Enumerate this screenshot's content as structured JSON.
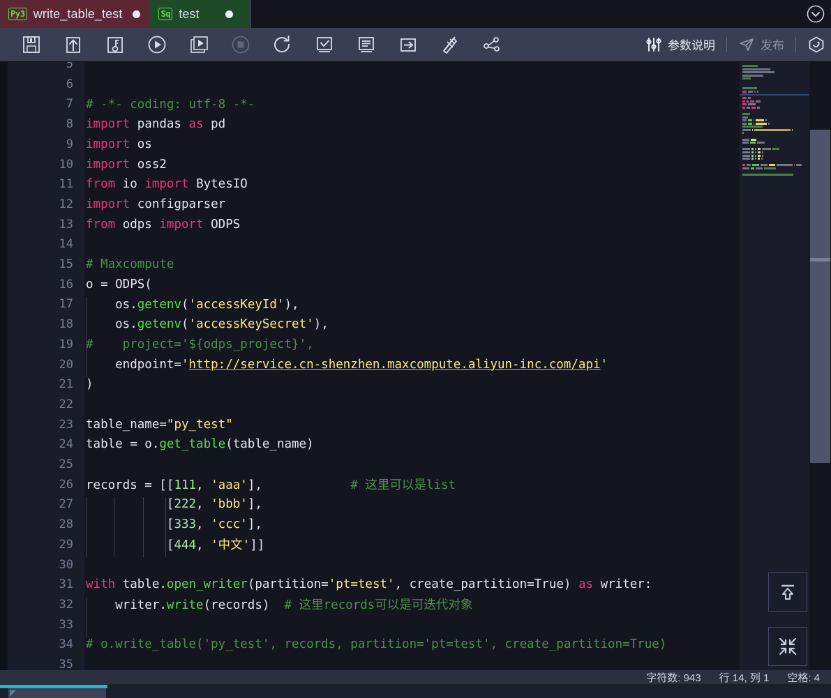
{
  "tabs": [
    {
      "badge": "Py3",
      "label": "write_table_test",
      "modified": true,
      "kind": "python",
      "active": true
    },
    {
      "badge": "Sq",
      "label": "test",
      "modified": true,
      "kind": "sql",
      "active": false
    }
  ],
  "titlebar": {
    "collapse_icon": "chevron-down-circle-icon"
  },
  "toolbar": {
    "buttons": [
      {
        "name": "save-button",
        "icon": "floppy-disk-icon",
        "enabled": true
      },
      {
        "name": "upload-button",
        "icon": "upload-box-icon",
        "enabled": true
      },
      {
        "name": "debug-button",
        "icon": "key-box-icon",
        "enabled": true
      },
      {
        "name": "run-button",
        "icon": "play-circle-icon",
        "enabled": true
      },
      {
        "name": "run-step-button",
        "icon": "play-box-icon",
        "enabled": true
      },
      {
        "name": "stop-button",
        "icon": "stop-circle-icon",
        "enabled": false
      },
      {
        "name": "refresh-button",
        "icon": "refresh-icon",
        "enabled": true
      },
      {
        "name": "check-button",
        "icon": "check-box-icon",
        "enabled": true
      },
      {
        "name": "format-button",
        "icon": "lines-box-icon",
        "enabled": true
      },
      {
        "name": "run-to-cursor-button",
        "icon": "arrow-right-box-icon",
        "enabled": true
      },
      {
        "name": "beautify-button",
        "icon": "pencil-ruler-icon",
        "enabled": true
      },
      {
        "name": "lineage-button",
        "icon": "node-graph-icon",
        "enabled": true
      }
    ],
    "params_label": "参数说明",
    "params_icon": "sliders-icon",
    "publish_label": "发布",
    "publish_icon": "send-icon",
    "publish_enabled": false,
    "more_icon": "hexagon-icon"
  },
  "editor": {
    "first_visible_line": 5,
    "lines": [
      {
        "n": 5,
        "tokens": []
      },
      {
        "n": 6,
        "tokens": []
      },
      {
        "n": 7,
        "tokens": [
          {
            "t": "# -*- coding: utf-8 -*-",
            "c": "cmt"
          }
        ]
      },
      {
        "n": 8,
        "tokens": [
          {
            "t": "import",
            "c": "kw"
          },
          {
            "t": " pandas ",
            "c": "pl"
          },
          {
            "t": "as",
            "c": "kw"
          },
          {
            "t": " pd",
            "c": "pl"
          }
        ]
      },
      {
        "n": 9,
        "tokens": [
          {
            "t": "import",
            "c": "kw"
          },
          {
            "t": " os",
            "c": "pl"
          }
        ]
      },
      {
        "n": 10,
        "tokens": [
          {
            "t": "import",
            "c": "kw"
          },
          {
            "t": " oss2",
            "c": "pl"
          }
        ]
      },
      {
        "n": 11,
        "tokens": [
          {
            "t": "from",
            "c": "kw"
          },
          {
            "t": " io ",
            "c": "pl"
          },
          {
            "t": "import",
            "c": "kw"
          },
          {
            "t": " BytesIO",
            "c": "pl"
          }
        ]
      },
      {
        "n": 12,
        "tokens": [
          {
            "t": "import",
            "c": "kw"
          },
          {
            "t": " configparser",
            "c": "pl"
          }
        ]
      },
      {
        "n": 13,
        "tokens": [
          {
            "t": "from",
            "c": "kw"
          },
          {
            "t": " odps ",
            "c": "pl"
          },
          {
            "t": "import",
            "c": "kw"
          },
          {
            "t": " ODPS",
            "c": "pl"
          }
        ]
      },
      {
        "n": 14,
        "tokens": []
      },
      {
        "n": 15,
        "tokens": [
          {
            "t": "# Maxcompute",
            "c": "cmt"
          }
        ]
      },
      {
        "n": 16,
        "tokens": [
          {
            "t": "o = ODPS(",
            "c": "pl"
          }
        ]
      },
      {
        "n": 17,
        "tokens": [
          {
            "t": "    os.",
            "c": "pl"
          },
          {
            "t": "getenv",
            "c": "fn"
          },
          {
            "t": "(",
            "c": "pl"
          },
          {
            "t": "'accessKeyId'",
            "c": "str"
          },
          {
            "t": "),",
            "c": "pl"
          }
        ]
      },
      {
        "n": 18,
        "tokens": [
          {
            "t": "    os.",
            "c": "pl"
          },
          {
            "t": "getenv",
            "c": "fn"
          },
          {
            "t": "(",
            "c": "pl"
          },
          {
            "t": "'accessKeySecret'",
            "c": "str"
          },
          {
            "t": "),",
            "c": "pl"
          }
        ]
      },
      {
        "n": 19,
        "tokens": [
          {
            "t": "#    project='${odps_project}',",
            "c": "cmt"
          }
        ]
      },
      {
        "n": 20,
        "tokens": [
          {
            "t": "    endpoint=",
            "c": "pl"
          },
          {
            "t": "'",
            "c": "str"
          },
          {
            "t": "http://service.cn-shenzhen.maxcompute.aliyun-inc.com/api",
            "c": "url"
          },
          {
            "t": "'",
            "c": "str"
          }
        ]
      },
      {
        "n": 21,
        "tokens": [
          {
            "t": ")",
            "c": "pl"
          }
        ]
      },
      {
        "n": 22,
        "tokens": []
      },
      {
        "n": 23,
        "tokens": [
          {
            "t": "table_name=",
            "c": "pl"
          },
          {
            "t": "\"py_test\"",
            "c": "str"
          }
        ]
      },
      {
        "n": 24,
        "tokens": [
          {
            "t": "table = o.",
            "c": "pl"
          },
          {
            "t": "get_table",
            "c": "fn"
          },
          {
            "t": "(table_name)",
            "c": "pl"
          }
        ]
      },
      {
        "n": 25,
        "tokens": []
      },
      {
        "n": 26,
        "tokens": [
          {
            "t": "records = [[",
            "c": "pl"
          },
          {
            "t": "111",
            "c": "num"
          },
          {
            "t": ", ",
            "c": "pl"
          },
          {
            "t": "'aaa'",
            "c": "str"
          },
          {
            "t": "],            ",
            "c": "pl"
          },
          {
            "t": "# 这里可以是list",
            "c": "cmt"
          }
        ]
      },
      {
        "n": 27,
        "tokens": [
          {
            "t": "           [",
            "c": "pl"
          },
          {
            "t": "222",
            "c": "num"
          },
          {
            "t": ", ",
            "c": "pl"
          },
          {
            "t": "'bbb'",
            "c": "str"
          },
          {
            "t": "],",
            "c": "pl"
          }
        ]
      },
      {
        "n": 28,
        "tokens": [
          {
            "t": "           [",
            "c": "pl"
          },
          {
            "t": "333",
            "c": "num"
          },
          {
            "t": ", ",
            "c": "pl"
          },
          {
            "t": "'ccc'",
            "c": "str"
          },
          {
            "t": "],",
            "c": "pl"
          }
        ]
      },
      {
        "n": 29,
        "tokens": [
          {
            "t": "           [",
            "c": "pl"
          },
          {
            "t": "444",
            "c": "num"
          },
          {
            "t": ", ",
            "c": "pl"
          },
          {
            "t": "'中文'",
            "c": "str"
          },
          {
            "t": "]]",
            "c": "pl"
          }
        ]
      },
      {
        "n": 30,
        "tokens": []
      },
      {
        "n": 31,
        "tokens": [
          {
            "t": "with",
            "c": "kw"
          },
          {
            "t": " table.",
            "c": "pl"
          },
          {
            "t": "open_writer",
            "c": "fn"
          },
          {
            "t": "(partition=",
            "c": "pl"
          },
          {
            "t": "'pt=test'",
            "c": "str"
          },
          {
            "t": ", create_partition=True) ",
            "c": "pl"
          },
          {
            "t": "as",
            "c": "kw"
          },
          {
            "t": " writer:",
            "c": "pl"
          }
        ]
      },
      {
        "n": 32,
        "tokens": [
          {
            "t": "    writer.",
            "c": "pl"
          },
          {
            "t": "write",
            "c": "fn"
          },
          {
            "t": "(records)  ",
            "c": "pl"
          },
          {
            "t": "# 这里records可以是可迭代对象",
            "c": "cmt"
          }
        ]
      },
      {
        "n": 33,
        "tokens": []
      },
      {
        "n": 34,
        "tokens": [
          {
            "t": "# o.write_table('py_test', records, partition='pt=test', create_partition=True)",
            "c": "cmt"
          }
        ]
      },
      {
        "n": 35,
        "tokens": []
      }
    ],
    "scroll_to_top_icon": "arrow-up-bar-icon",
    "collapse_all_icon": "collapse-arrows-icon"
  },
  "statusbar": {
    "char_count": "字符数: 943",
    "cursor": "行 14, 列 1",
    "indent": "空格: 4"
  },
  "colors": {
    "tab_python": "#5c2733",
    "tab_sql": "#1f4a28",
    "toolbar": "#3a3e52",
    "editor_bg": "#14161f",
    "gutter_bg": "#1a1d29",
    "keyword": "#f0337a",
    "function": "#5ed94a",
    "string": "#ffe87a",
    "number": "#a8e6a0",
    "comment": "#4e8f4a",
    "plain": "#e3e7f2",
    "accent": "#1fb6cf"
  }
}
